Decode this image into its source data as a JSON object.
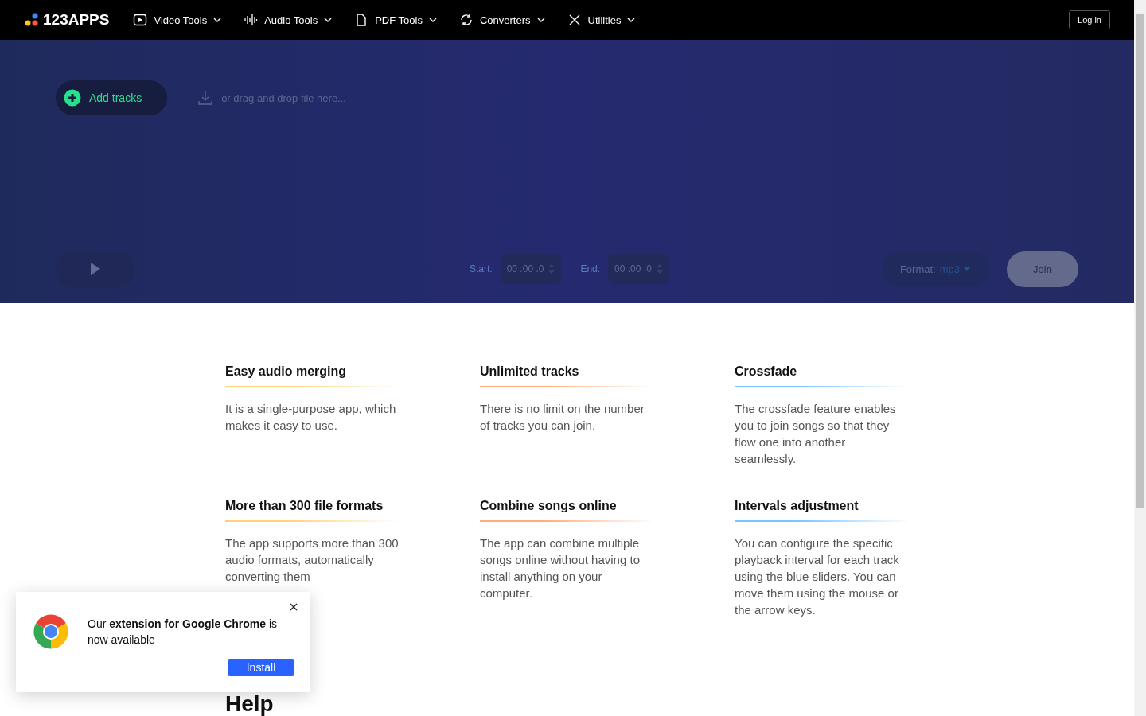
{
  "header": {
    "logo": "123APPS",
    "nav": [
      {
        "label": "Video Tools"
      },
      {
        "label": "Audio Tools"
      },
      {
        "label": "PDF Tools"
      },
      {
        "label": "Converters"
      },
      {
        "label": "Utilities"
      }
    ],
    "login": "Log in"
  },
  "editor": {
    "add_button": "Add tracks",
    "drop_hint": "or drag and drop file here...",
    "start_label": "Start:",
    "start_value": "00 :00 .0",
    "end_label": "End:",
    "end_value": "00 :00 .0",
    "format_label": "Format:",
    "format_value": "mp3",
    "join_button": "Join"
  },
  "features": [
    {
      "title": "Easy audio merging",
      "text": "It is a single-purpose app, which makes it easy to use.",
      "color": "#ffd27a"
    },
    {
      "title": "Unlimited tracks",
      "text": "There is no limit on the number of tracks you can join.",
      "color": "#ffab7a"
    },
    {
      "title": "Crossfade",
      "text": "The crossfade feature enables you to join songs so that they flow one into another seamlessly.",
      "color": "#7ac4ff"
    },
    {
      "title": "More than 300 file formats",
      "text": "The app supports more than 300 audio formats, automatically converting them",
      "color": "#ffd27a"
    },
    {
      "title": "Combine songs online",
      "text": "The app can combine multiple songs online without having to install anything on your computer.",
      "color": "#ffab7a"
    },
    {
      "title": "Intervals adjustment",
      "text": "You can configure the specific playback interval for each track using the blue sliders. You can move them using the mouse or the arrow keys.",
      "color": "#7ac4ff"
    }
  ],
  "help_title": "Help",
  "popup": {
    "text": "Our **extension for Google Chrome** is now available",
    "button": "Install"
  }
}
